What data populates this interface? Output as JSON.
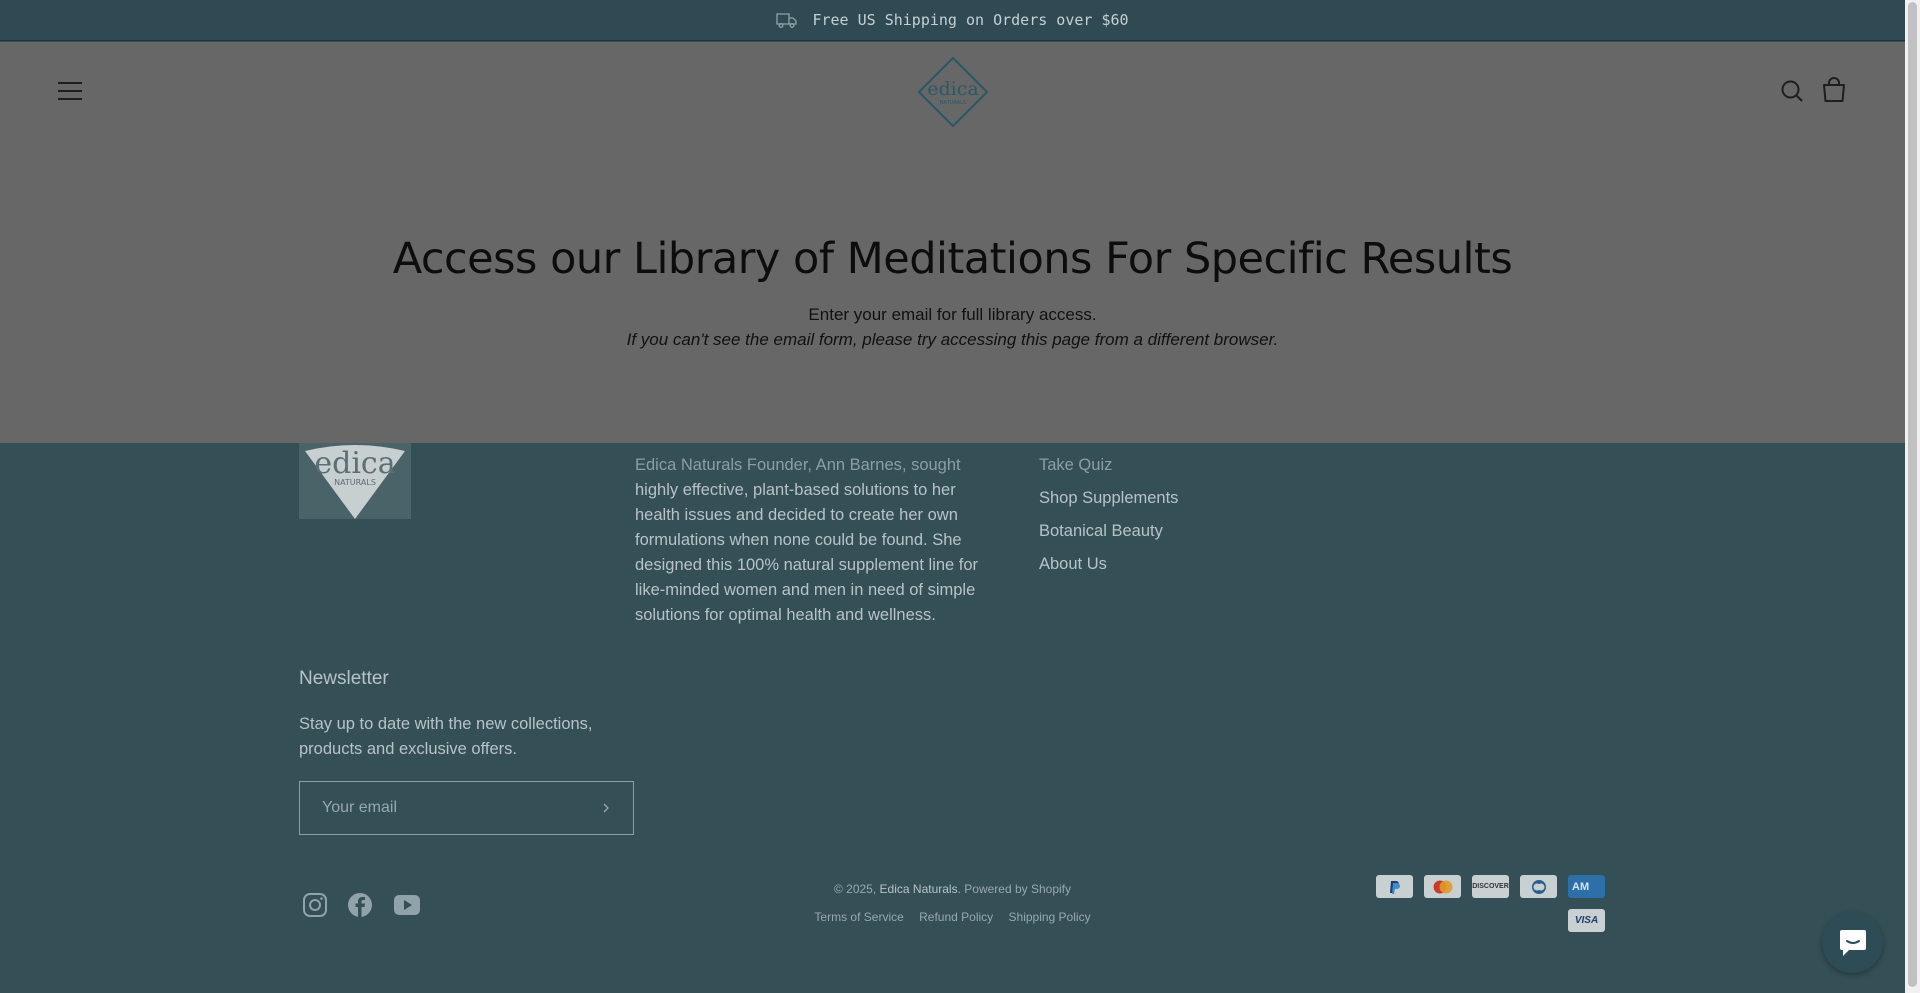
{
  "announcement": {
    "text": "Free US Shipping on Orders over $60",
    "icon": "truck-icon"
  },
  "header": {
    "logo_text": "edica",
    "logo_subtext": "NATURALS",
    "menu_icon": "hamburger-icon",
    "search_icon": "search-icon",
    "cart_icon": "shopping-bag-icon"
  },
  "hero": {
    "title": "Access our Library of Meditations For Specific Results",
    "line1": "Enter your email for full library access.",
    "line2": "If you can't see the email form, please try accessing this page from a different browser."
  },
  "footer": {
    "logo_text": "edica",
    "logo_subtext": "NATURALS",
    "about_first": "Edica Naturals Founder, Ann Barnes, sought",
    "about_rest": "highly effective, plant-based solutions to her health issues and decided to create her own formulations when none could be found. She designed this 100% natural supplement line for like-minded women and men in need of simple solutions for optimal health and wellness.",
    "links": [
      "Take Quiz",
      "Shop Supplements",
      "Botanical Beauty",
      "About Us"
    ],
    "newsletter": {
      "title": "Newsletter",
      "text": "Stay up to date with the new collections, products and exclusive offers.",
      "placeholder": "Your email"
    },
    "social": [
      "instagram-icon",
      "facebook-icon",
      "youtube-icon"
    ],
    "copyright_prefix": "© 2025,",
    "copyright_brand": "Edica Naturals",
    "copyright_suffix": ". Powered by Shopify",
    "policies": [
      "Terms of Service",
      "Refund Policy",
      "Shipping Policy"
    ],
    "payments": {
      "paypal": "PayPal",
      "mastercard": "Mastercard",
      "discover": "DISCOVER",
      "diners": "Diners Club",
      "amex": "AMERICAN EXPRESS",
      "visa": "VISA"
    }
  },
  "colors": {
    "announcement_bg": "#2f4a52",
    "overlay": "#676767",
    "footer_bg": "#354f57",
    "chat_bg": "#2d4c55"
  }
}
